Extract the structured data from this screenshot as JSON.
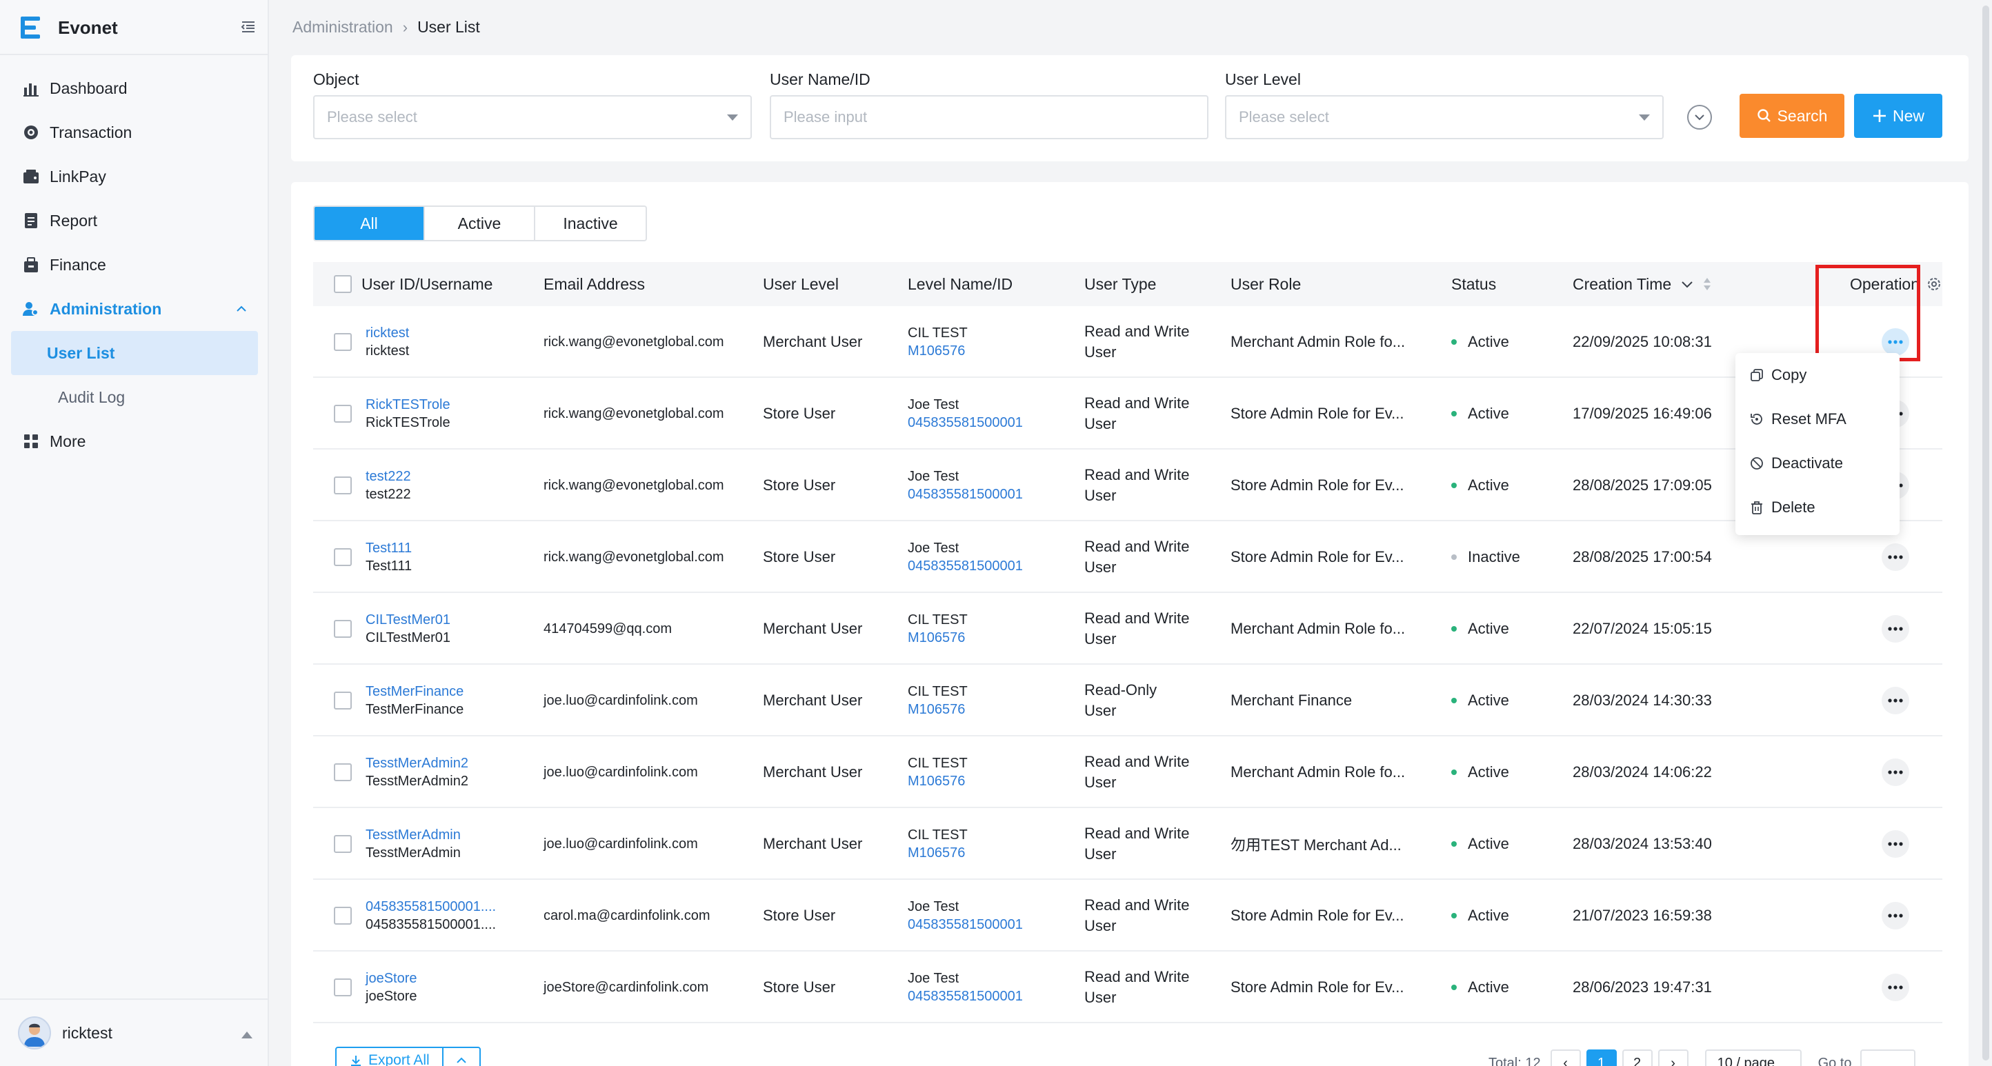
{
  "app": {
    "name": "Evonet"
  },
  "sidebar": {
    "items": [
      {
        "label": "Dashboard",
        "icon": "bar-chart-icon"
      },
      {
        "label": "Transaction",
        "icon": "transaction-icon"
      },
      {
        "label": "LinkPay",
        "icon": "wallet-icon"
      },
      {
        "label": "Report",
        "icon": "report-icon"
      },
      {
        "label": "Finance",
        "icon": "finance-icon"
      },
      {
        "label": "Administration",
        "icon": "admin-users-icon",
        "expanded": true
      },
      {
        "label": "User List",
        "selected": true
      },
      {
        "label": "Audit Log"
      },
      {
        "label": "More",
        "icon": "grid-icon"
      }
    ],
    "user": {
      "name": "ricktest"
    }
  },
  "breadcrumb": {
    "parent": "Administration",
    "current": "User List"
  },
  "filters": {
    "object": {
      "label": "Object",
      "placeholder": "Please select"
    },
    "username": {
      "label": "User Name/ID",
      "placeholder": "Please input"
    },
    "level": {
      "label": "User Level",
      "placeholder": "Please select"
    },
    "search_label": "Search",
    "new_label": "New"
  },
  "tabs": [
    "All",
    "Active",
    "Inactive"
  ],
  "table": {
    "columns": [
      "User ID/Username",
      "Email Address",
      "User Level",
      "Level Name/ID",
      "User Type",
      "User Role",
      "Status",
      "Creation Time",
      "Operation"
    ],
    "rows": [
      {
        "id": "ricktest",
        "username": "ricktest",
        "email": "rick.wang@evonetglobal.com",
        "level": "Merchant User",
        "level_name": "CIL TEST",
        "level_id": "M106576",
        "type1": "Read and Write",
        "type2": "User",
        "role": "Merchant Admin Role fo...",
        "status": "Active",
        "created": "22/09/2025 10:08:31"
      },
      {
        "id": "RickTESTrole",
        "username": "RickTESTrole",
        "email": "rick.wang@evonetglobal.com",
        "level": "Store User",
        "level_name": "Joe Test",
        "level_id": "045835581500001",
        "type1": "Read and Write",
        "type2": "User",
        "role": "Store Admin Role for Ev...",
        "status": "Active",
        "created": "17/09/2025 16:49:06"
      },
      {
        "id": "test222",
        "username": "test222",
        "email": "rick.wang@evonetglobal.com",
        "level": "Store User",
        "level_name": "Joe Test",
        "level_id": "045835581500001",
        "type1": "Read and Write",
        "type2": "User",
        "role": "Store Admin Role for Ev...",
        "status": "Active",
        "created": "28/08/2025 17:09:05"
      },
      {
        "id": "Test111",
        "username": "Test111",
        "email": "rick.wang@evonetglobal.com",
        "level": "Store User",
        "level_name": "Joe Test",
        "level_id": "045835581500001",
        "type1": "Read and Write",
        "type2": "User",
        "role": "Store Admin Role for Ev...",
        "status": "Inactive",
        "created": "28/08/2025 17:00:54"
      },
      {
        "id": "CILTestMer01",
        "username": "CILTestMer01",
        "email": "414704599@qq.com",
        "level": "Merchant User",
        "level_name": "CIL TEST",
        "level_id": "M106576",
        "type1": "Read and Write",
        "type2": "User",
        "role": "Merchant Admin Role fo...",
        "status": "Active",
        "created": "22/07/2024 15:05:15"
      },
      {
        "id": "TestMerFinance",
        "username": "TestMerFinance",
        "email": "joe.luo@cardinfolink.com",
        "level": "Merchant User",
        "level_name": "CIL TEST",
        "level_id": "M106576",
        "type1": "Read-Only",
        "type2": "User",
        "role": "Merchant Finance",
        "status": "Active",
        "created": "28/03/2024 14:30:33"
      },
      {
        "id": "TesstMerAdmin2",
        "username": "TesstMerAdmin2",
        "email": "joe.luo@cardinfolink.com",
        "level": "Merchant User",
        "level_name": "CIL TEST",
        "level_id": "M106576",
        "type1": "Read and Write",
        "type2": "User",
        "role": "Merchant Admin Role fo...",
        "status": "Active",
        "created": "28/03/2024 14:06:22"
      },
      {
        "id": "TesstMerAdmin",
        "username": "TesstMerAdmin",
        "email": "joe.luo@cardinfolink.com",
        "level": "Merchant User",
        "level_name": "CIL TEST",
        "level_id": "M106576",
        "type1": "Read and Write",
        "type2": "User",
        "role": "勿用TEST Merchant Ad...",
        "status": "Active",
        "created": "28/03/2024 13:53:40"
      },
      {
        "id": "045835581500001....",
        "username": "045835581500001....",
        "email": "carol.ma@cardinfolink.com",
        "level": "Store User",
        "level_name": "Joe Test",
        "level_id": "045835581500001",
        "type1": "Read and Write",
        "type2": "User",
        "role": "Store Admin Role for Ev...",
        "status": "Active",
        "created": "21/07/2023 16:59:38"
      },
      {
        "id": "joeStore",
        "username": "joeStore",
        "email": "joeStore@cardinfolink.com",
        "level": "Store User",
        "level_name": "Joe Test",
        "level_id": "045835581500001",
        "type1": "Read and Write",
        "type2": "User",
        "role": "Store Admin Role for Ev...",
        "status": "Active",
        "created": "28/06/2023 19:47:31"
      }
    ]
  },
  "operation_menu": [
    "Copy",
    "Reset MFA",
    "Deactivate",
    "Delete"
  ],
  "footer": {
    "export_label": "Export All",
    "total": "Total: 12",
    "pages": [
      "1",
      "2"
    ],
    "page_size": "10 / page",
    "goto_label": "Go to"
  },
  "colors": {
    "accent": "#1d9ef0",
    "search": "#fa8a2d",
    "active_dot": "#2ab27b",
    "inactive_dot": "#b8bec6",
    "highlight": "#e51f1f"
  }
}
